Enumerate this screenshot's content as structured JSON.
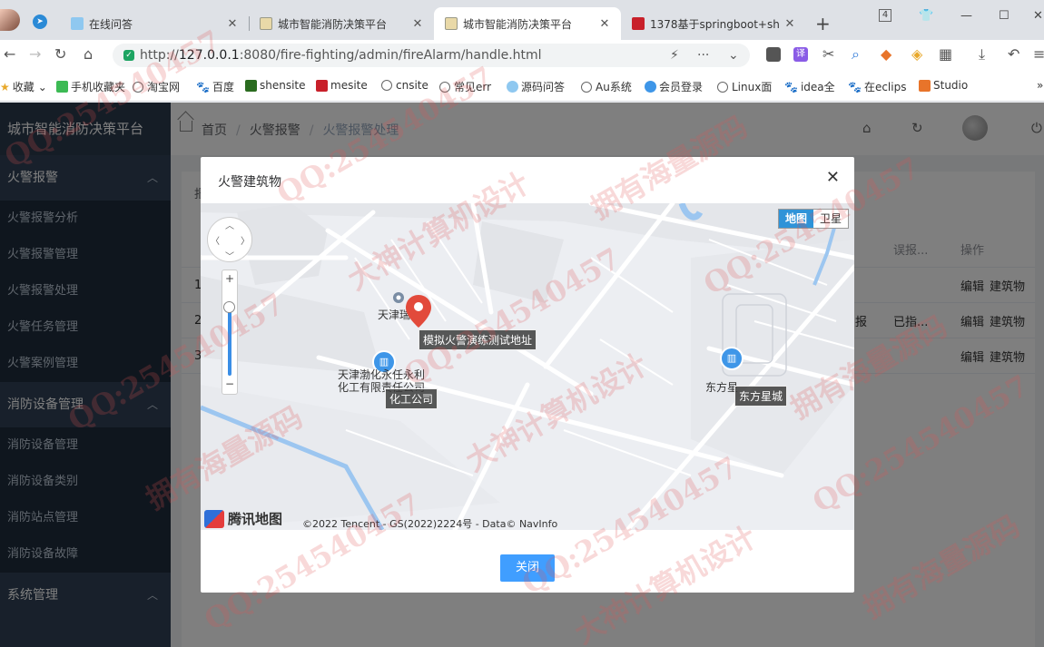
{
  "browser": {
    "tabs": [
      {
        "title": "在线问答",
        "active": false
      },
      {
        "title": "城市智能消防决策平台",
        "active": false
      },
      {
        "title": "城市智能消防决策平台",
        "active": true
      },
      {
        "title": "1378基于springboot+sh",
        "active": false
      }
    ],
    "tab_count_badge": "4",
    "url_prefix": "http://",
    "url_host": "127.0.0.1",
    "url_rest": ":8080/fire-fighting/admin/fireAlarm/handle.html",
    "bookmarks": [
      "收藏",
      "手机收藏夹",
      "淘宝网",
      "百度",
      "shensite",
      "mesite",
      "cnsite",
      "常见err",
      "源码问答",
      "Au系统",
      "会员登录",
      "Linux面",
      "idea全",
      "在eclips",
      "Studio"
    ],
    "menu_more_glyph": "»"
  },
  "app": {
    "title": "城市智能消防决策平台",
    "menu": [
      {
        "label": "火警报警",
        "items": [
          "火警报警分析",
          "火警报警管理",
          "火警报警处理",
          "火警任务管理",
          "火警案例管理"
        ]
      },
      {
        "label": "消防设备管理",
        "items": [
          "消防设备管理",
          "消防设备类别",
          "消防站点管理",
          "消防设备故障"
        ]
      },
      {
        "label": "系统管理",
        "items": []
      }
    ],
    "breadcrumb": [
      "首页",
      "火警报警",
      "火警报警处理"
    ]
  },
  "table": {
    "filter_label": "报",
    "headers": {
      "misreport": "误报...",
      "actions": "操作"
    },
    "rows": [
      {
        "index": "1",
        "col_a": "",
        "misreport": "",
        "edit": "编辑",
        "building": "建筑物"
      },
      {
        "index": "2",
        "col_a": "报",
        "misreport": "已指...",
        "edit": "编辑",
        "building": "建筑物"
      },
      {
        "index": "3",
        "col_a": "",
        "misreport": "",
        "edit": "编辑",
        "building": "建筑物"
      }
    ]
  },
  "dialog": {
    "title": "火警建筑物",
    "close_button": "关闭",
    "map": {
      "type_map": "地图",
      "type_satellite": "卫星",
      "marker_label": "模拟火警演练测试地址",
      "poi_tianjin_short": "天津瑞",
      "poi_chem_name_line1": "天津渤化永任永利",
      "poi_chem_name_line2": "化工有限责任公司",
      "poi_chem_label": "化工公司",
      "poi_dongfang_name": "东方星",
      "poi_dongfang_label": "东方星城",
      "brand": "腾讯地图",
      "copyright": "©2022 Tencent - GS(2022)2224号 - Data© NavInfo"
    }
  },
  "watermarks": [
    "QQ:254540457",
    "拥有海量源码",
    "大神计算机设计"
  ]
}
